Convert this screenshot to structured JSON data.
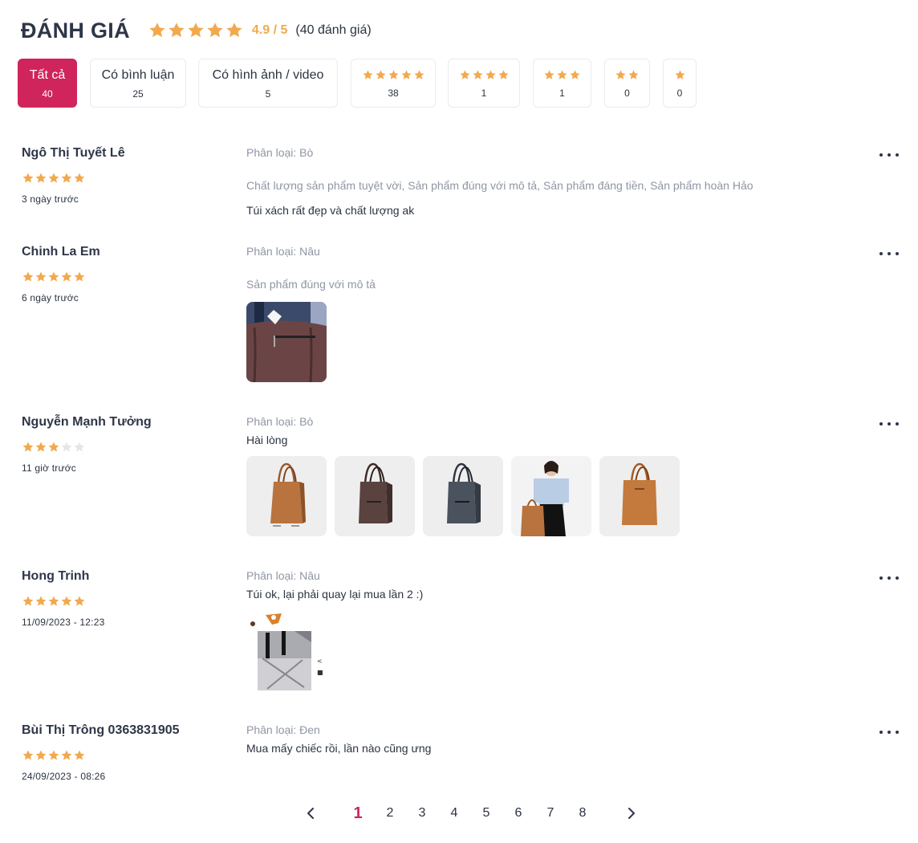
{
  "header": {
    "title": "ĐÁNH GIÁ",
    "rating": 5,
    "score_text": "4.9 / 5",
    "count_text": "(40 đánh giá)"
  },
  "colors": {
    "star": "#f2a94e",
    "star_empty": "#e4e6ea",
    "accent": "#d0245c"
  },
  "filters": [
    {
      "label": "Tất cả",
      "count": "40",
      "active": true
    },
    {
      "label": "Có bình luận",
      "count": "25"
    },
    {
      "label": "Có hình ảnh / video",
      "count": "5"
    },
    {
      "stars": 5,
      "count": "38"
    },
    {
      "stars": 4,
      "count": "1"
    },
    {
      "stars": 3,
      "count": "1"
    },
    {
      "stars": 2,
      "count": "0"
    },
    {
      "stars": 1,
      "count": "0"
    }
  ],
  "reviews": [
    {
      "name": "Ngô Thị Tuyết Lê",
      "rating": 5,
      "date": "3 ngày trước",
      "variant": "Phân loại: Bò",
      "tags": "Chất lượng sản phẩm tuyệt vời, Sản phẩm đúng với mô tả, Sản phẩm đáng tiền, Sản phẩm hoàn Hảo",
      "text": "Túi xách rất đẹp và chất lượng ak"
    },
    {
      "name": "Chinh La Em",
      "rating": 5,
      "date": "6 ngày trước",
      "variant": "Phân loại: Nâu",
      "tags": "Sản phẩm đúng với mô tả",
      "text": "",
      "photos": [
        "brown-bag-closeup"
      ]
    },
    {
      "name": "Nguyễn Mạnh Tưởng",
      "rating": 3,
      "date": "11 giờ trước",
      "variant": "Phân loại: Bò",
      "text": "Hài lòng",
      "photos": [
        "tan-tote",
        "dark-brown-tote",
        "grey-tote",
        "model-with-tote",
        "orange-tote"
      ]
    },
    {
      "name": "Hong Trinh",
      "rating": 5,
      "date": "11/09/2023 - 12:23",
      "variant": "Phân loại: Nâu",
      "text": "Túi ok, lại phải quay lại mua lần 2 :)",
      "photos": [
        "bag-in-plastic"
      ]
    },
    {
      "name": "Bùi Thị Trông 0363831905",
      "rating": 5,
      "date": "24/09/2023 - 08:26",
      "variant": "Phân loại: Đen",
      "text": "Mua mấy chiếc rồi, lần nào cũng ưng"
    }
  ],
  "pagination": {
    "prev_icon": "chevron-left-icon",
    "next_icon": "chevron-right-icon",
    "pages": [
      "1",
      "2",
      "3",
      "4",
      "5",
      "6",
      "7",
      "8"
    ],
    "current": "1"
  }
}
